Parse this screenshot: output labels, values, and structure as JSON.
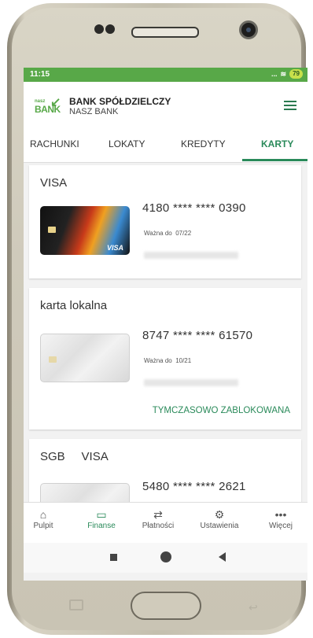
{
  "status": {
    "time": "11:15",
    "signal": "...",
    "battery": "79"
  },
  "app": {
    "logo_small": "nasz",
    "logo_big": "BANK",
    "name": "BANK SPÓŁDZIELCZY",
    "subname": "NASZ BANK"
  },
  "tabs": [
    {
      "label": "RACHUNKI",
      "active": false
    },
    {
      "label": "LOKATY",
      "active": false
    },
    {
      "label": "KREDYTY",
      "active": false
    },
    {
      "label": "KARTY",
      "active": true
    }
  ],
  "cards": [
    {
      "title": "VISA",
      "number": "4180 **** **** 0390",
      "expiry_label": "Ważna do",
      "expiry": "07/22",
      "card_brand": "VISA"
    },
    {
      "title": "karta lokalna",
      "number": "8747 **** **** 61570",
      "expiry_label": "Ważna do",
      "expiry": "10/21",
      "status": "TYMCZASOWO ZABLOKOWANA"
    },
    {
      "title_left": "SGB",
      "title_right": "VISA",
      "number": "5480 **** **** 2621"
    }
  ],
  "bottom_nav": [
    {
      "label": "Pulpit",
      "icon": "home-icon",
      "active": false
    },
    {
      "label": "Finanse",
      "icon": "wallet-icon",
      "active": true
    },
    {
      "label": "Płatności",
      "icon": "transfer-icon",
      "active": false
    },
    {
      "label": "Ustawienia",
      "icon": "gear-icon",
      "active": false
    },
    {
      "label": "Więcej",
      "icon": "more-icon",
      "active": false
    }
  ],
  "colors": {
    "accent": "#2a8a5a",
    "status_bar": "#58a848"
  }
}
